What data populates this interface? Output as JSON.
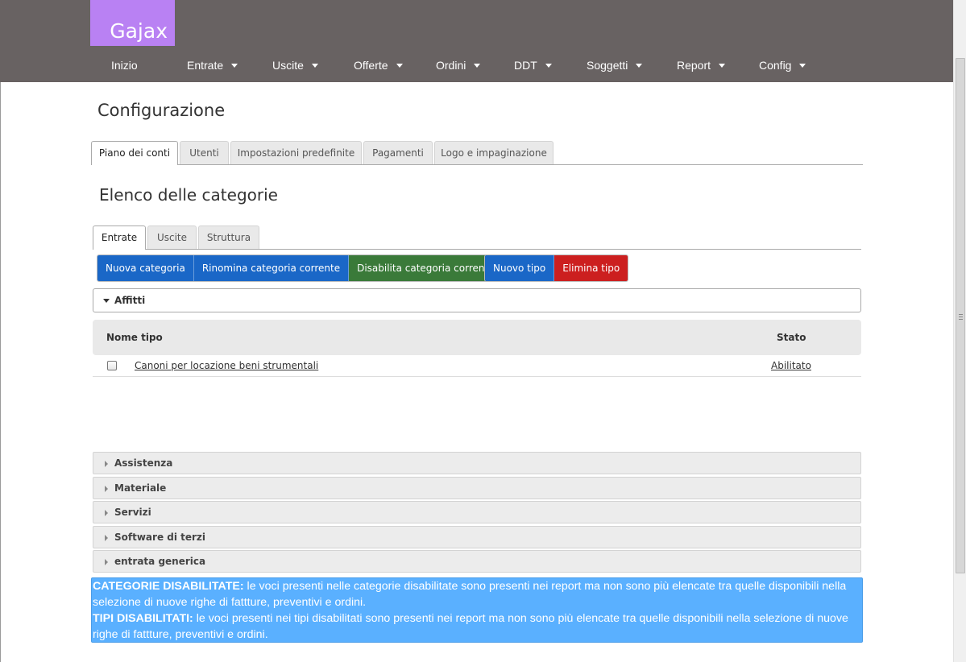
{
  "app": {
    "logo": "Gajax",
    "nav": [
      {
        "label": "Inizio",
        "dropdown": false
      },
      {
        "label": "Entrate",
        "dropdown": true
      },
      {
        "label": "Uscite",
        "dropdown": true
      },
      {
        "label": "Offerte",
        "dropdown": true
      },
      {
        "label": "Ordini",
        "dropdown": true
      },
      {
        "label": "DDT",
        "dropdown": true
      },
      {
        "label": "Soggetti",
        "dropdown": true
      },
      {
        "label": "Report",
        "dropdown": true
      },
      {
        "label": "Config",
        "dropdown": true
      }
    ]
  },
  "page": {
    "title": "Configurazione",
    "main_tabs": [
      "Piano dei conti",
      "Utenti",
      "Impostazioni predefinite",
      "Pagamenti",
      "Logo e impaginazione"
    ],
    "main_tab_active": "Piano dei conti",
    "section_title": "Elenco delle categorie",
    "sub_tabs": [
      "Entrate",
      "Uscite",
      "Struttura"
    ],
    "sub_tab_active": "Entrate"
  },
  "buttons": {
    "new_category": "Nuova categoria",
    "rename_category": "Rinomina categoria corrente",
    "disable_category": "Disabilita categoria corrente",
    "new_type": "Nuovo tipo",
    "delete_type": "Elimina tipo"
  },
  "open_category": {
    "name": "Affitti",
    "table": {
      "headers": [
        "Nome tipo",
        "Stato"
      ],
      "rows": [
        {
          "name": "Canoni per locazione beni strumentali",
          "state": "Abilitato",
          "checked": false
        }
      ]
    }
  },
  "collapsed_categories": [
    "Assistenza",
    "Materiale",
    "Servizi",
    "Software di terzi",
    "entrata generica"
  ],
  "info": {
    "cat_label": "CATEGORIE DISABILITATE:",
    "cat_text": " le voci presenti nelle categorie disabilitate sono presenti nei report ma non sono più elencate tra quelle disponibili nella selezione di nuove righe di fattture, preventivi e ordini.",
    "type_label": "TIPI DISABILITATI:",
    "type_text": " le voci presenti nei tipi disabilitati sono presenti nei report ma non sono più elencate tra quelle disponibili nella selezione di nuove righe di fattture, preventivi e ordini."
  },
  "colors": {
    "header_bg": "#686262",
    "logo_bg": "#b981f3",
    "btn_blue": "#1a67c7",
    "btn_green": "#3a7a39",
    "btn_red": "#cc1f1f",
    "info_bg": "#5ab0ff"
  }
}
